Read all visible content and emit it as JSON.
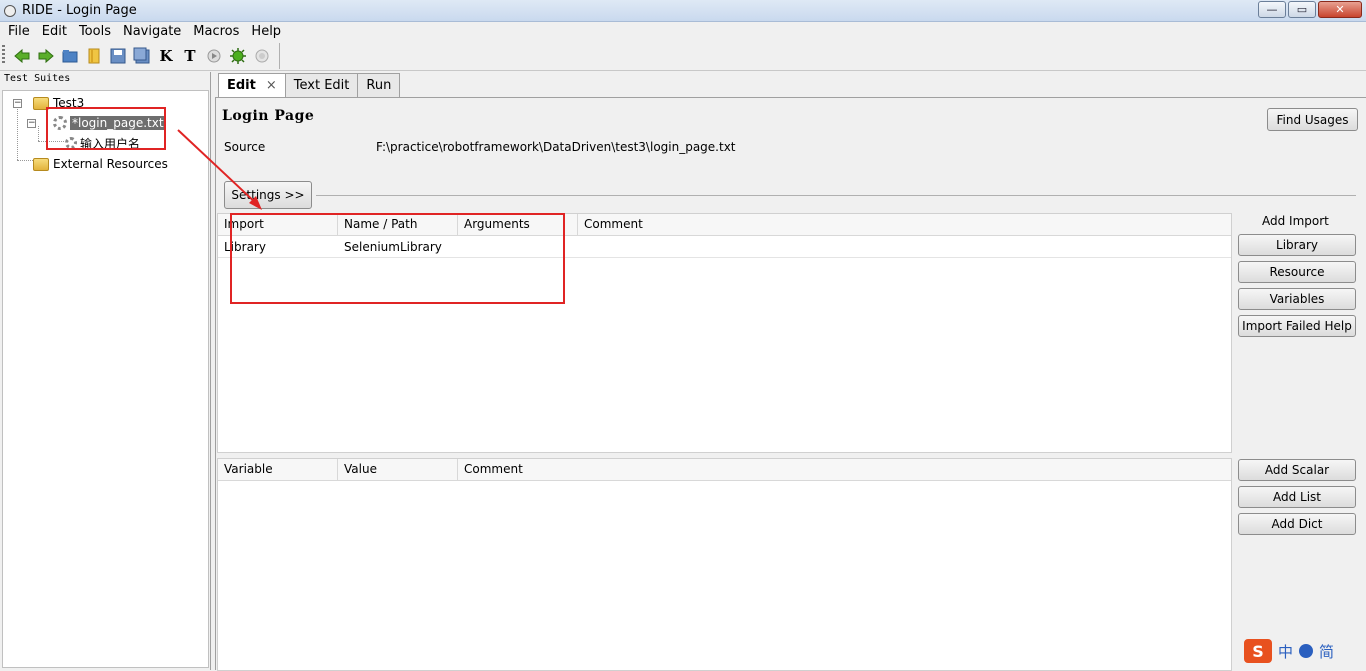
{
  "window": {
    "title": "RIDE - Login Page",
    "min": "—",
    "max": "▭",
    "close": "✕"
  },
  "menu": [
    "File",
    "Edit",
    "Tools",
    "Navigate",
    "Macros",
    "Help"
  ],
  "toolbar": {
    "icons": [
      "back-arrow-icon",
      "forward-arrow-icon",
      "open-folder-icon",
      "open-directory-icon",
      "save-icon",
      "save-all-icon",
      "keyword-search-icon",
      "test-search-icon",
      "run-icon",
      "debug-icon",
      "stop-icon"
    ],
    "k_letter": "K",
    "t_letter": "T"
  },
  "left_panel": {
    "header": "Test Suites",
    "tree": {
      "root": "Test3",
      "file": "*login_page.txt",
      "child": "输入用户名",
      "external": "External Resources"
    }
  },
  "tabs": [
    {
      "label": "Edit",
      "close": "×"
    },
    {
      "label": "Text Edit"
    },
    {
      "label": "Run"
    }
  ],
  "editor": {
    "title": "Login Page",
    "source_label": "Source",
    "source_value": "F:\\practice\\robotframework\\DataDriven\\test3\\login_page.txt",
    "find_usages": "Find Usages",
    "settings_button": "Settings >>",
    "imports": {
      "columns": [
        "Import",
        "Name / Path",
        "Arguments",
        "Comment"
      ],
      "rows": [
        [
          "Library",
          "SeleniumLibrary",
          "",
          ""
        ]
      ]
    },
    "add_import": {
      "label": "Add Import",
      "buttons": [
        "Library",
        "Resource",
        "Variables",
        "Import Failed Help"
      ]
    },
    "variables": {
      "columns": [
        "Variable",
        "Value",
        "Comment"
      ],
      "rows": []
    },
    "add_variable_buttons": [
      "Add Scalar",
      "Add List",
      "Add Dict"
    ]
  },
  "tray": {
    "chars": [
      "中",
      "简"
    ]
  },
  "colors": {
    "annotation_red": "#e02424",
    "selection_gray": "#6e6e6e"
  }
}
